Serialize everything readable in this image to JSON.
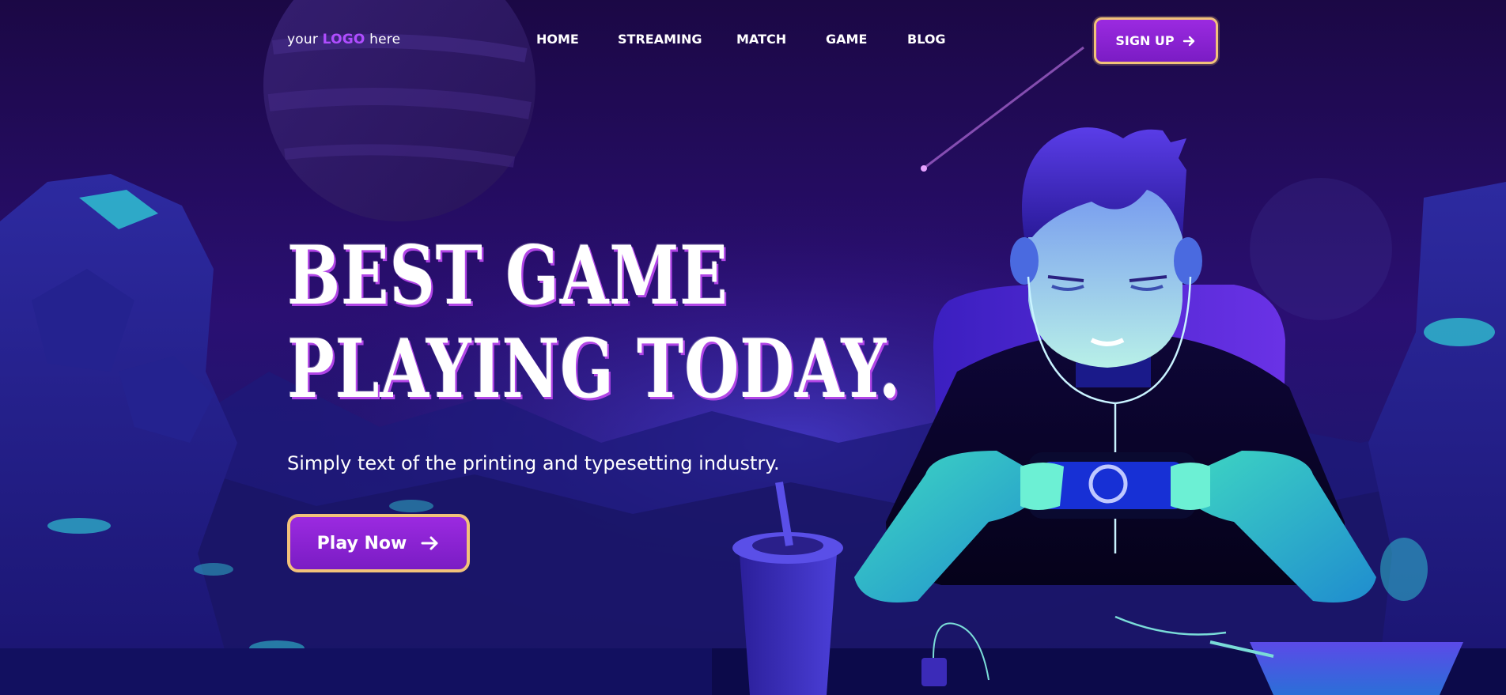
{
  "header": {
    "logo": {
      "prefix": "your",
      "accent": "LOGO",
      "suffix": "here"
    },
    "nav": [
      "HOME",
      "STREAMING",
      "MATCH",
      "GAME",
      "BLOG"
    ],
    "signup_label": "SIGN UP"
  },
  "hero": {
    "title_line1": "BEST GAME",
    "title_line2": "PLAYING TODAY.",
    "subtitle": "Simply text of the printing and typesetting industry.",
    "cta_label": "Play Now"
  },
  "colors": {
    "accent": "#b04dff",
    "button_fill": "#8a22d4",
    "button_border": "#f2c27a",
    "background": "#1a0a4a"
  },
  "icons": [
    "arrow-right-icon"
  ]
}
